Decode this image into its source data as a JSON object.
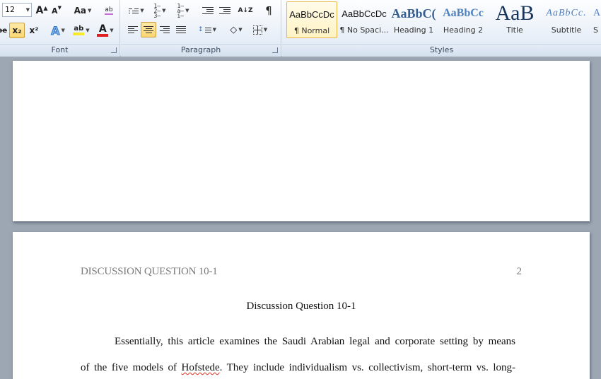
{
  "ribbon": {
    "font": {
      "label": "Font",
      "font_size": "12",
      "grow_font_glyph": "A",
      "shrink_font_glyph": "A",
      "change_case_label": "Aa",
      "clear_formatting_label": "ab",
      "strikethrough_label": "abe",
      "subscript_label": "x₂",
      "superscript_label": "x²",
      "text_effects_label": "A",
      "highlight_label": "ab",
      "font_color_label": "A",
      "font_color": "#e02020",
      "highlight_color": "#f7ea2a"
    },
    "paragraph": {
      "label": "Paragraph",
      "sort_label": "A↓Z",
      "show_marks_label": "¶",
      "active_alignment": "center"
    },
    "styles": {
      "label": "Styles",
      "items": [
        {
          "sample": "AaBbCcDc",
          "name": "¶ Normal",
          "selected": true
        },
        {
          "sample": "AaBbCcDc",
          "name": "¶ No Spaci..."
        },
        {
          "sample": "AaBbC(",
          "name": "Heading 1"
        },
        {
          "sample": "AaBbCc",
          "name": "Heading 2"
        },
        {
          "sample": "AaB",
          "name": "Title"
        },
        {
          "sample": "AaBbCc.",
          "name": "Subtitle"
        },
        {
          "sample": "A",
          "name": "S"
        }
      ],
      "heading_color": "#365f91",
      "heading2_color": "#4f81bd",
      "title_color": "#17365d"
    }
  },
  "document": {
    "page2": {
      "running_head": "DISCUSSION QUESTION 10-1",
      "page_number": "2",
      "title": "Discussion Question 10-1",
      "line1": "Essentially, this article examines the Saudi Arabian legal and corporate setting by means",
      "line2_before": "of the five models of ",
      "line2_flagged": "Hofstede",
      "line2_after": ". They include individualism vs. collectivism, short-term vs. long-"
    }
  }
}
